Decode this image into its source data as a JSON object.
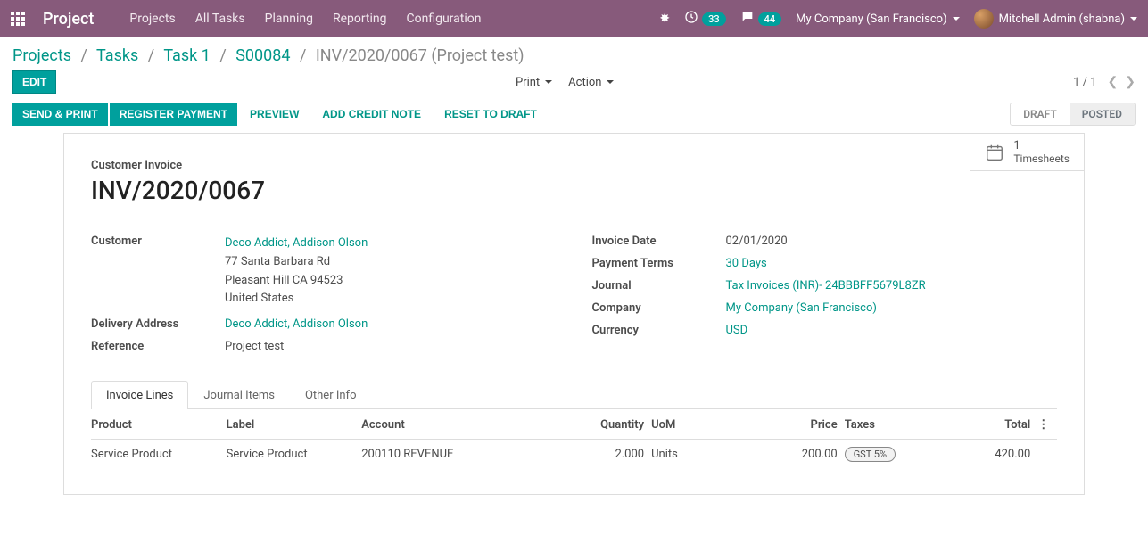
{
  "topnav": {
    "brand": "Project",
    "menu": [
      "Projects",
      "All Tasks",
      "Planning",
      "Reporting",
      "Configuration"
    ],
    "activities_badge": "33",
    "messages_badge": "44",
    "company": "My Company (San Francisco)",
    "user": "Mitchell Admin (shabna)"
  },
  "breadcrumb": {
    "items": [
      "Projects",
      "Tasks",
      "Task 1",
      "S00084"
    ],
    "current": "INV/2020/0067 (Project test)"
  },
  "controls": {
    "edit": "EDIT",
    "print": "Print",
    "action": "Action",
    "pager": "1 / 1"
  },
  "actionbar": {
    "send_print": "SEND & PRINT",
    "register_payment": "REGISTER PAYMENT",
    "preview": "PREVIEW",
    "add_credit_note": "ADD CREDIT NOTE",
    "reset_to_draft": "RESET TO DRAFT",
    "status_draft": "DRAFT",
    "status_posted": "POSTED"
  },
  "stat": {
    "count": "1",
    "label": "Timesheets"
  },
  "record": {
    "kicker": "Customer Invoice",
    "name": "INV/2020/0067",
    "customer_label": "Customer",
    "customer": "Deco Addict, Addison Olson",
    "address_line1": "77 Santa Barbara Rd",
    "address_line2": "Pleasant Hill CA 94523",
    "address_country": "United States",
    "delivery_label": "Delivery Address",
    "delivery": "Deco Addict, Addison Olson",
    "reference_label": "Reference",
    "reference": "Project test",
    "invoice_date_label": "Invoice Date",
    "invoice_date": "02/01/2020",
    "payment_terms_label": "Payment Terms",
    "payment_terms": "30 Days",
    "journal_label": "Journal",
    "journal": "Tax Invoices (INR)- 24BBBFF5679L8ZR",
    "company_label": "Company",
    "company": "My Company (San Francisco)",
    "currency_label": "Currency",
    "currency": "USD"
  },
  "tabs": {
    "lines": "Invoice Lines",
    "journal": "Journal Items",
    "other": "Other Info"
  },
  "table": {
    "headers": {
      "product": "Product",
      "label": "Label",
      "account": "Account",
      "quantity": "Quantity",
      "uom": "UoM",
      "price": "Price",
      "taxes": "Taxes",
      "total": "Total"
    },
    "row": {
      "product": "Service Product",
      "label": "Service Product",
      "account": "200110 REVENUE",
      "quantity": "2.000",
      "uom": "Units",
      "price": "200.00",
      "taxes": "GST 5%",
      "total": "420.00"
    }
  }
}
